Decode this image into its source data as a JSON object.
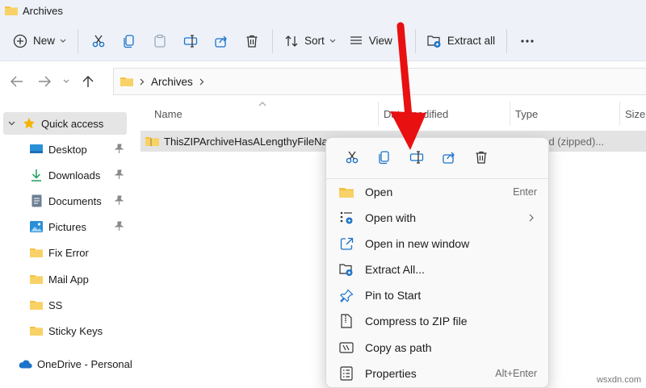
{
  "window": {
    "title": "Archives"
  },
  "toolbar": {
    "new_label": "New",
    "sort_label": "Sort",
    "view_label": "View",
    "extract_all_label": "Extract all"
  },
  "address": {
    "crumb": "Archives"
  },
  "columns": {
    "name": "Name",
    "date_modified": "Date modified",
    "type": "Type",
    "size": "Size"
  },
  "file": {
    "name": "ThisZIPArchiveHasALengthyFileName",
    "type": "essed (zipped)..."
  },
  "sidebar": {
    "items": [
      {
        "label": "Quick access"
      },
      {
        "label": "Desktop"
      },
      {
        "label": "Downloads"
      },
      {
        "label": "Documents"
      },
      {
        "label": "Pictures"
      },
      {
        "label": "Fix Error"
      },
      {
        "label": "Mail App"
      },
      {
        "label": "SS"
      },
      {
        "label": "Sticky Keys"
      },
      {
        "label": "OneDrive - Personal"
      }
    ]
  },
  "context_menu": {
    "items": [
      {
        "label": "Open",
        "shortcut": "Enter"
      },
      {
        "label": "Open with"
      },
      {
        "label": "Open in new window"
      },
      {
        "label": "Extract All..."
      },
      {
        "label": "Pin to Start"
      },
      {
        "label": "Compress to ZIP file"
      },
      {
        "label": "Copy as path"
      },
      {
        "label": "Properties",
        "shortcut": "Alt+Enter"
      }
    ]
  },
  "watermark": "wsxdn.com",
  "colors": {
    "folder": "#f4c145",
    "accent": "#1a73c9",
    "arrow": "#e81010"
  }
}
